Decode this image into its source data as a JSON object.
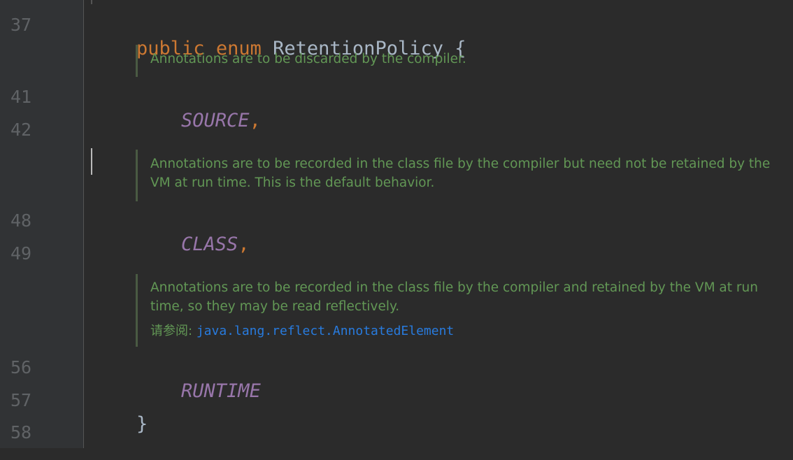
{
  "gutter": {
    "line_numbers": [
      "37",
      "41",
      "42",
      "48",
      "49",
      "56",
      "57",
      "58"
    ]
  },
  "code": {
    "kw_public": "public",
    "kw_enum": "enum",
    "class_name": "RetentionPolicy",
    "open_brace": "{",
    "close_brace": "}",
    "constants": [
      {
        "name": "SOURCE",
        "punct": ","
      },
      {
        "name": "CLASS",
        "punct": ","
      },
      {
        "name": "RUNTIME",
        "punct": ""
      }
    ]
  },
  "docs": [
    {
      "text": "Annotations are to be discarded by the compiler."
    },
    {
      "text": "Annotations are to be recorded in the class file by the compiler but need not be retained by the VM at run time. This is the default behavior."
    },
    {
      "text": "Annotations are to be recorded in the class file by the compiler and retained by the VM at run time, so they may be read reflectively.",
      "see_label": "请参阅:",
      "see_link": "java.lang.reflect.AnnotatedElement"
    }
  ],
  "colors": {
    "background": "#2b2b2b",
    "keyword": "#cc7832",
    "constant": "#9876aa",
    "doc_comment": "#629755",
    "link": "#287bde",
    "line_number": "#606366"
  }
}
